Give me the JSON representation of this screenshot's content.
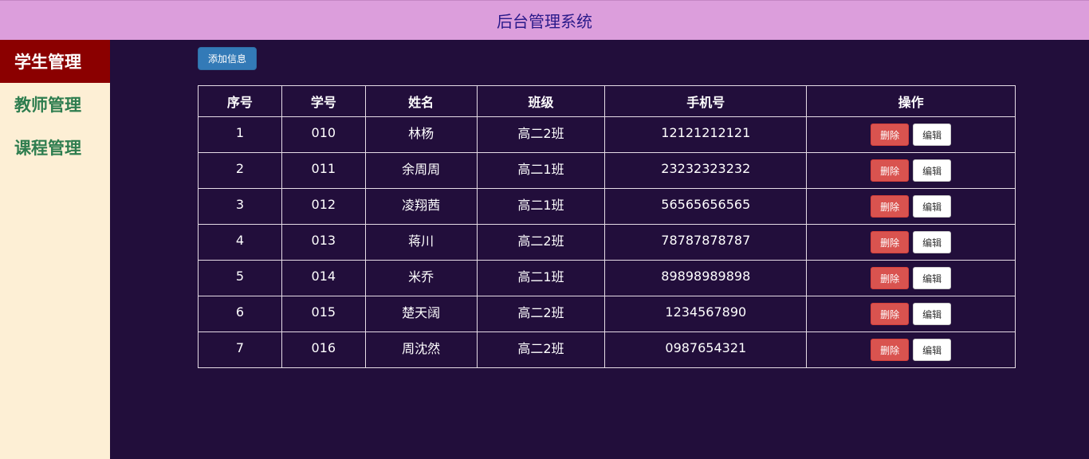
{
  "header": {
    "title": "后台管理系统"
  },
  "sidebar": {
    "items": [
      {
        "label": "学生管理",
        "active": true
      },
      {
        "label": "教师管理",
        "active": false
      },
      {
        "label": "课程管理",
        "active": false
      }
    ]
  },
  "toolbar": {
    "add_label": "添加信息"
  },
  "table": {
    "columns": [
      "序号",
      "学号",
      "姓名",
      "班级",
      "手机号",
      "操作"
    ],
    "delete_label": "删除",
    "edit_label": "编辑",
    "rows": [
      {
        "index": "1",
        "id": "010",
        "name": "林杨",
        "class": "高二2班",
        "phone": "12121212121"
      },
      {
        "index": "2",
        "id": "011",
        "name": "余周周",
        "class": "高二1班",
        "phone": "23232323232"
      },
      {
        "index": "3",
        "id": "012",
        "name": "凌翔茜",
        "class": "高二1班",
        "phone": "56565656565"
      },
      {
        "index": "4",
        "id": "013",
        "name": "蒋川",
        "class": "高二2班",
        "phone": "78787878787"
      },
      {
        "index": "5",
        "id": "014",
        "name": "米乔",
        "class": "高二1班",
        "phone": "89898989898"
      },
      {
        "index": "6",
        "id": "015",
        "name": "楚天阔",
        "class": "高二2班",
        "phone": "1234567890"
      },
      {
        "index": "7",
        "id": "016",
        "name": "周沈然",
        "class": "高二2班",
        "phone": "0987654321"
      }
    ]
  },
  "colors": {
    "header_bg": "#dc9edc",
    "page_bg": "#220e3b",
    "sidebar_bg": "#fdefd5",
    "sidebar_active_bg": "#8b0000",
    "sidebar_text": "#2e7d4f",
    "primary": "#337ab7",
    "danger": "#d9534f"
  }
}
